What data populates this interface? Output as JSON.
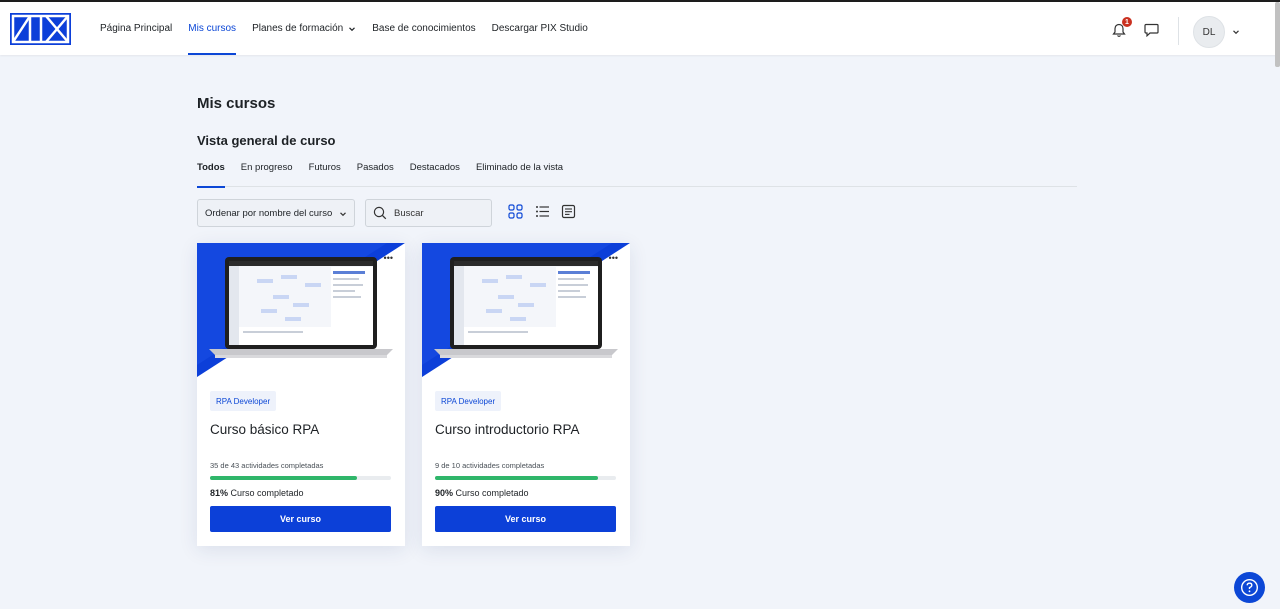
{
  "navbar": {
    "logo": "PIX",
    "items": [
      {
        "label": "Página Principal",
        "active": false
      },
      {
        "label": "Mis cursos",
        "active": true
      },
      {
        "label": "Planes de formación",
        "active": false,
        "dropdown": true
      },
      {
        "label": "Base de conocimientos",
        "active": false
      },
      {
        "label": "Descargar PIX Studio",
        "active": false
      }
    ],
    "notification_count": "1",
    "user_initials": "DL"
  },
  "page": {
    "title": "Mis cursos",
    "section_title": "Vista general de curso",
    "tabs": [
      {
        "label": "Todos",
        "active": true
      },
      {
        "label": "En progreso"
      },
      {
        "label": "Futuros"
      },
      {
        "label": "Pasados"
      },
      {
        "label": "Destacados"
      },
      {
        "label": "Eliminado de la vista"
      }
    ],
    "sort_label": "Ordenar por nombre del curso",
    "search_placeholder": "Buscar",
    "view_icons": [
      "grid-view-icon",
      "list-view-icon",
      "summary-view-icon"
    ]
  },
  "courses": [
    {
      "category": "RPA Developer",
      "name": "Curso básico RPA",
      "activities": "35 de 43 actividades completadas",
      "progress": 0.81,
      "percent": "81%",
      "completion_suffix": " Curso completado",
      "button": "Ver curso"
    },
    {
      "category": "RPA Developer",
      "name": "Curso introductorio RPA",
      "activities": "9 de 10 actividades completadas",
      "progress": 0.9,
      "percent": "90%",
      "completion_suffix": " Curso completado",
      "button": "Ver curso"
    }
  ],
  "colors": {
    "brand": "#0c47d6",
    "button": "#0c40d8",
    "progress": "#2fb66a",
    "badge": "#ca3120",
    "background": "#f1f4fa"
  }
}
